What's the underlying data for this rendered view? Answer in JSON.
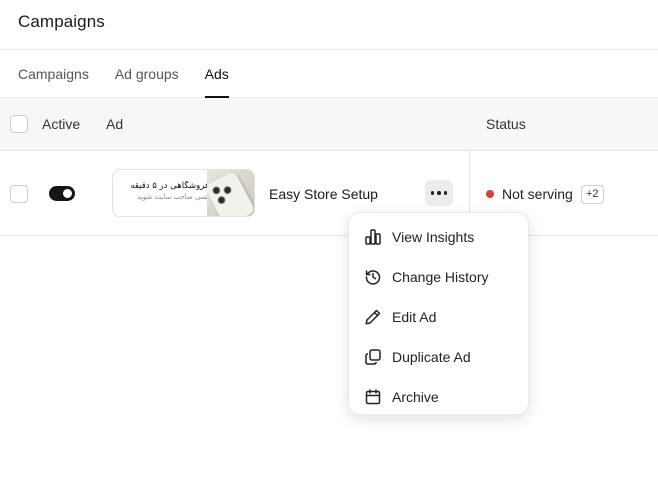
{
  "page": {
    "title": "Campaigns"
  },
  "tabs": [
    {
      "label": "Campaigns",
      "active": false
    },
    {
      "label": "Ad groups",
      "active": false
    },
    {
      "label": "Ads",
      "active": true
    }
  ],
  "table": {
    "headers": {
      "active": "Active",
      "ad": "Ad",
      "status": "Status"
    },
    "rows": [
      {
        "active": true,
        "ad_preview": {
          "headline": "فروشگاهی در ۵ دقیقه",
          "subline": "بسی صاحب سایت شوید",
          "thumbnail": "phone-image"
        },
        "ad_name": "Easy Store Setup",
        "status": {
          "label": "Not serving",
          "color": "#d93f3f",
          "extra_count": "+2"
        }
      }
    ]
  },
  "context_menu": {
    "items": [
      {
        "label": "View Insights",
        "icon": "bar-chart-icon"
      },
      {
        "label": "Change History",
        "icon": "history-icon"
      },
      {
        "label": "Edit Ad",
        "icon": "pencil-icon"
      },
      {
        "label": "Duplicate Ad",
        "icon": "duplicate-icon"
      },
      {
        "label": "Archive",
        "icon": "archive-icon"
      }
    ]
  }
}
